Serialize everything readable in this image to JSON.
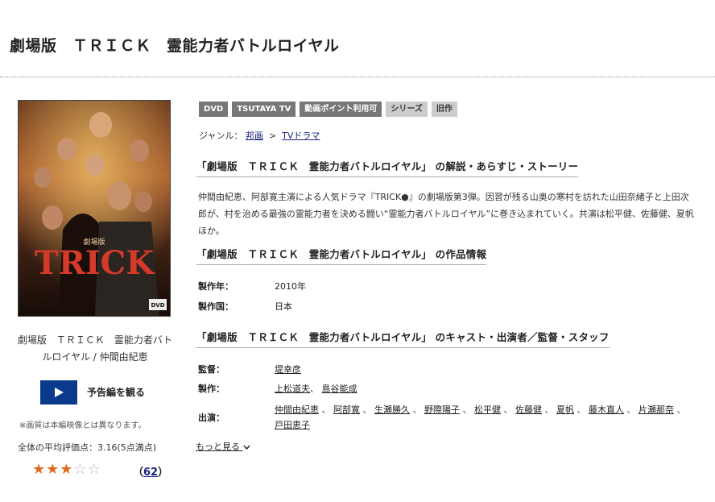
{
  "page": {
    "title": "劇場版　ＴＲＩＣＫ　霊能力者バトルロイヤル"
  },
  "poster": {
    "title_text": "TRICK",
    "logo_text": "劇場版",
    "dvd_label": "DVD"
  },
  "left": {
    "caption": "劇場版　ＴＲＩＣＫ　霊能力者バトルロイヤル / 仲間由紀恵",
    "trailer_label": "予告編を観る",
    "note": "※画質は本編映像とは異なります。",
    "avg_rating": "全体の平均評価点：3.16(5点満点)",
    "review_count": "62",
    "rating_stars": 3,
    "rating_max": 5
  },
  "tags": [
    "DVD",
    "TSUTAYA TV",
    "動画ポイント利用可",
    "シリーズ",
    "旧作"
  ],
  "genre": {
    "label": "ジャンル：",
    "items": [
      "邦画",
      "TVドラマ"
    ],
    "sep": ">"
  },
  "sections": {
    "story_heading": "「劇場版　ＴＲＩＣＫ　霊能力者バトルロイヤル」 の解説・あらすじ・ストーリー",
    "story_text": "仲間由紀恵、阿部寛主演による人気ドラマ『TRICK●』の劇場版第3弾。因習が残る山奥の寒村を訪れた山田奈緒子と上田次郎が、村を治める最強の霊能力者を決める闘い“霊能力者バトルロイヤル”に巻き込まれていく。共演は松平健、佐藤健、夏帆ほか。",
    "info_heading": "「劇場版　ＴＲＩＣＫ　霊能力者バトルロイヤル」 の作品情報",
    "cast_heading": "「劇場版　ＴＲＩＣＫ　霊能力者バトルロイヤル」 のキャスト・出演者／監督・スタッフ"
  },
  "info": {
    "year_label": "製作年：",
    "year": "2010年",
    "country_label": "製作国：",
    "country": "日本"
  },
  "staff": {
    "director_label": "監督：",
    "director": [
      "堤幸彦"
    ],
    "producer_label": "製作：",
    "producers": [
      "上松道夫",
      "島谷能成"
    ],
    "cast_label": "出演：",
    "cast": [
      "仲間由紀恵",
      "阿部寛",
      "生瀬勝久",
      "野際陽子",
      "松平健",
      "佐藤健",
      "夏帆",
      "藤木直人",
      "片瀬那奈",
      "戸田恵子"
    ]
  },
  "more_label": "もっと見る",
  "colors": {
    "trailer_button": "#0a3a8c",
    "star": "#e06a1c",
    "tag_dark": "#777777",
    "tag_light": "#cccccc"
  }
}
